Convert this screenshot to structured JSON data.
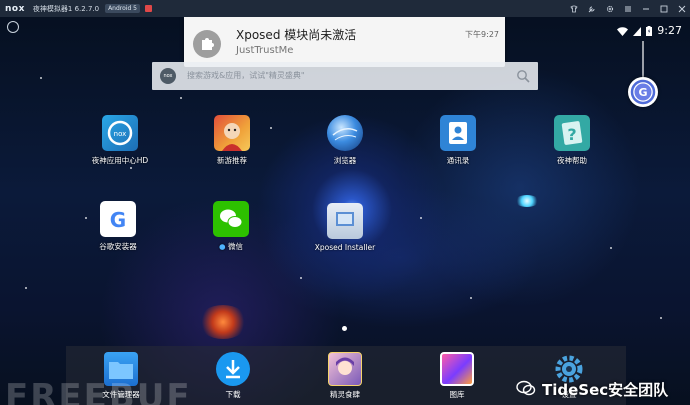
{
  "titlebar": {
    "logo": "nox",
    "title": "夜神模拟器1 6.2.7.0",
    "badge": "Android 5",
    "icons": [
      "shirt-icon",
      "wrench-icon",
      "gear-icon",
      "menu-icon",
      "minimize-icon",
      "maximize-icon",
      "close-icon"
    ]
  },
  "status": {
    "time": "9:27",
    "icons": [
      "wifi-icon",
      "signal-icon",
      "battery-icon"
    ]
  },
  "notification": {
    "title": "Xposed 模块尚未激活",
    "text": "JustTrustMe",
    "time": "下午9:27",
    "icon": "puzzle-icon"
  },
  "search": {
    "placeholder": "搜索游戏&应用，试试\"精灵盛典\"",
    "logo": "nox"
  },
  "float_button": {
    "label": "G"
  },
  "apps": [
    {
      "label": "夜神应用中心HD",
      "icon": "nox-appcenter-icon"
    },
    {
      "label": "新游推荐",
      "icon": "game-character-icon"
    },
    {
      "label": "浏览器",
      "icon": "globe-icon"
    },
    {
      "label": "通讯录",
      "icon": "contacts-icon"
    },
    {
      "label": "夜神帮助",
      "icon": "help-icon"
    },
    {
      "label": "谷歌安装器",
      "icon": "google-icon"
    },
    {
      "label": "微信",
      "icon": "wechat-icon"
    },
    {
      "label": "Xposed Installer",
      "icon": "xposed-icon"
    }
  ],
  "dock": [
    {
      "label": "文件管理器",
      "icon": "folder-icon"
    },
    {
      "label": "下载",
      "icon": "download-icon"
    },
    {
      "label": "精灵食肆",
      "icon": "anime-game-icon"
    },
    {
      "label": "图库",
      "icon": "gallery-icon"
    },
    {
      "label": "设置",
      "icon": "settings-gear-icon"
    }
  ],
  "watermarks": {
    "freebuf": "FREEBUF",
    "tide": "TideSec安全团队"
  }
}
